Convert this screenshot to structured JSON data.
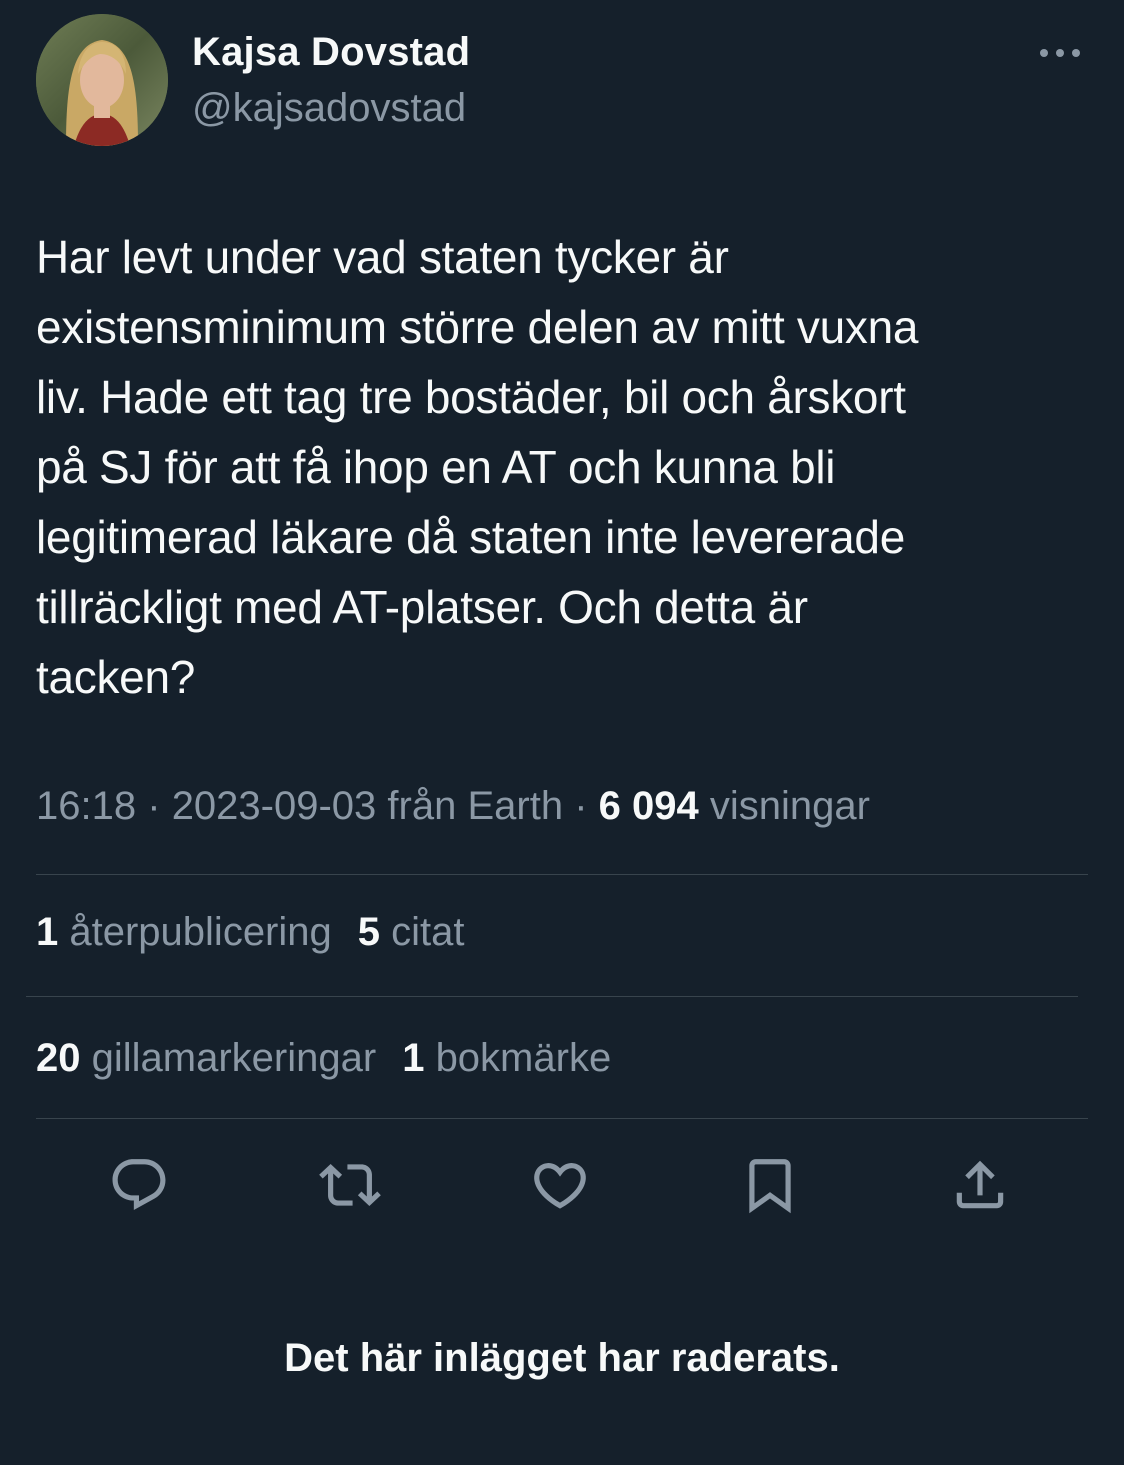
{
  "author": {
    "display_name": "Kajsa Dovstad",
    "handle": "@kajsadovstad"
  },
  "tweet": {
    "lines": [
      "Har levt under vad staten tycker är",
      "existensminimum större delen av mitt vuxna",
      "liv. Hade ett tag tre bostäder, bil och årskort",
      "på SJ för att få ihop en AT och kunna bli",
      "legitimerad läkare då staten inte levererade",
      "tillräckligt med AT-platser. Och detta är",
      "tacken?"
    ]
  },
  "meta": {
    "time": "16:18",
    "sep1": "·",
    "date": "2023-09-03",
    "source": "från Earth",
    "sep2": "·",
    "views_count": "6 094",
    "views_label": "visningar"
  },
  "stats": {
    "reposts_count": "1",
    "reposts_label": "återpublicering",
    "quotes_count": "5",
    "quotes_label": "citat",
    "likes_count": "20",
    "likes_label": "gillamarkeringar",
    "bookmarks_count": "1",
    "bookmarks_label": "bokmärke"
  },
  "actions": {
    "reply_icon": "reply-icon",
    "retweet_icon": "retweet-icon",
    "like_icon": "heart-icon",
    "bookmark_icon": "bookmark-icon",
    "share_icon": "share-icon"
  },
  "notice": {
    "deleted_text": "Det här inlägget har raderats."
  },
  "colors": {
    "background": "#15202b",
    "text_primary": "#f7f9f9",
    "text_secondary": "#8b98a5",
    "divider": "#38444d"
  }
}
